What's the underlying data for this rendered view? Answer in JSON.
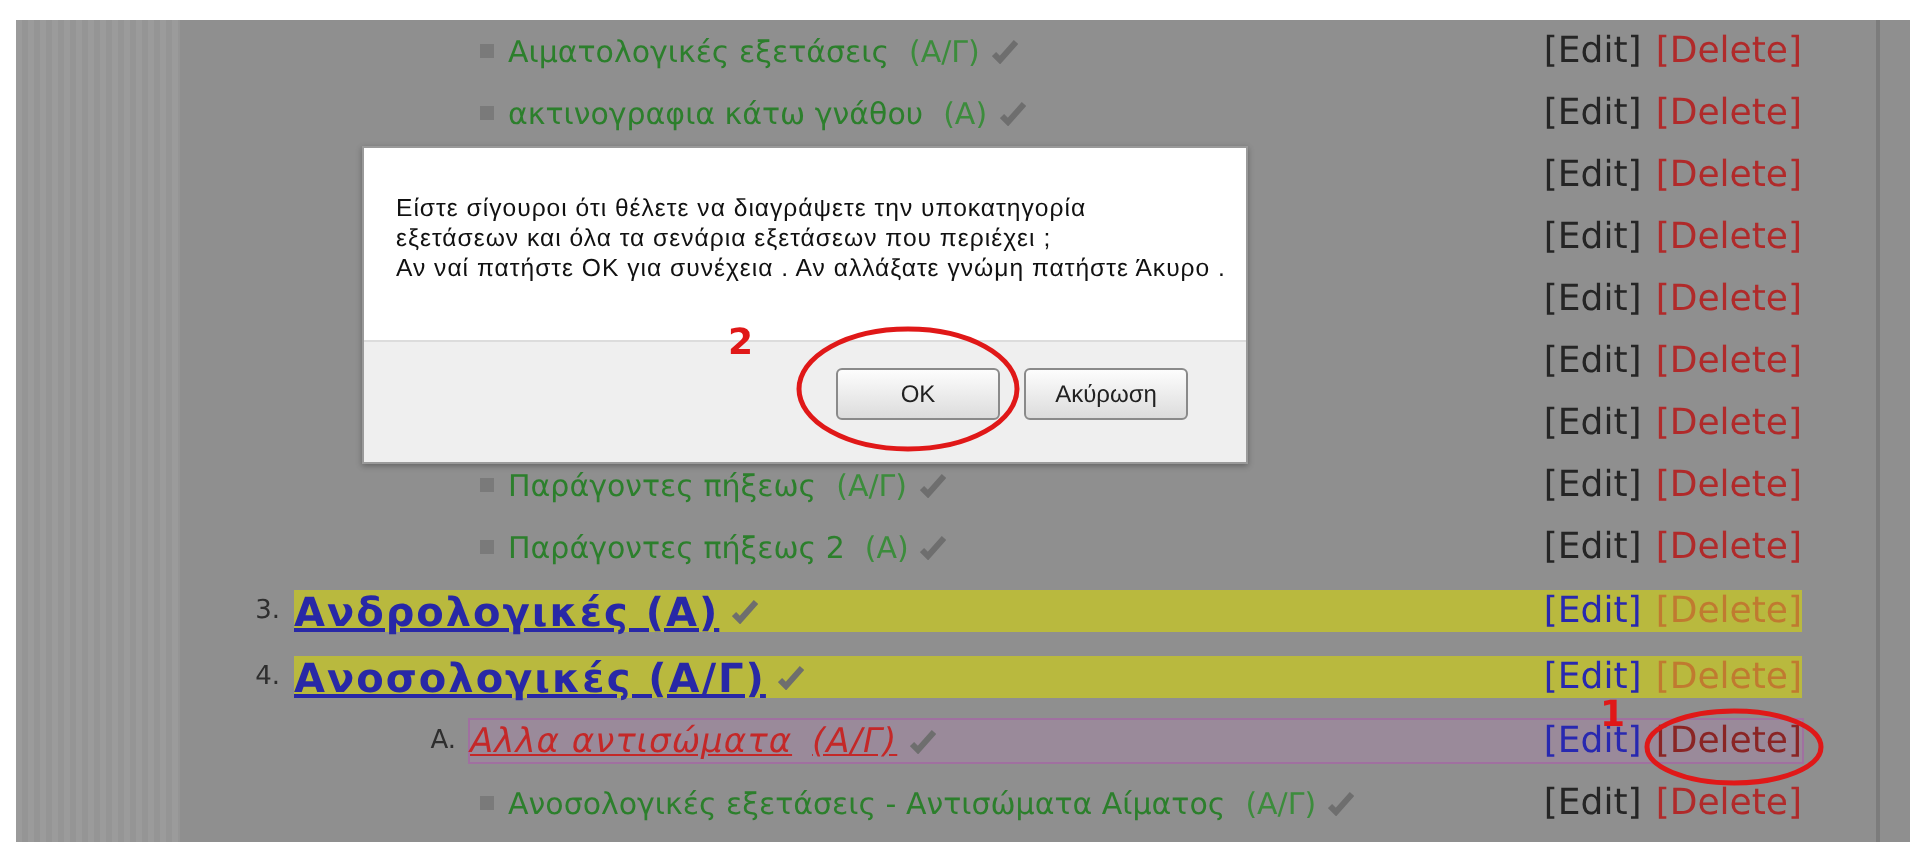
{
  "entries": [
    {
      "kind": "item",
      "name": "Αιματολογικές εξετάσεις",
      "tag": "(Α/Γ)",
      "edit": "[Edit]",
      "delete": "[Delete]"
    },
    {
      "kind": "item",
      "name": "ακτινογραφια κάτω γνάθου",
      "tag": "(Α)",
      "edit": "[Edit]",
      "delete": "[Delete]"
    },
    {
      "kind": "item",
      "edit": "[Edit]",
      "delete": "[Delete]"
    },
    {
      "kind": "item",
      "edit": "[Edit]",
      "delete": "[Delete]"
    },
    {
      "kind": "item",
      "edit": "[Edit]",
      "delete": "[Delete]"
    },
    {
      "kind": "item",
      "edit": "[Edit]",
      "delete": "[Delete]"
    },
    {
      "kind": "item",
      "edit": "[Edit]",
      "delete": "[Delete]"
    },
    {
      "kind": "item",
      "name": "Παράγοντες πήξεως",
      "tag": "(Α/Γ)",
      "edit": "[Edit]",
      "delete": "[Delete]"
    },
    {
      "kind": "item",
      "name": "Παράγοντες πήξεως 2",
      "tag": "(Α)",
      "edit": "[Edit]",
      "delete": "[Delete]"
    },
    {
      "kind": "category",
      "number": "3.",
      "name": "Ανδρολογικές (Α)",
      "edit": "[Edit]",
      "delete": "[Delete]"
    },
    {
      "kind": "category",
      "number": "4.",
      "name": "Ανοσολογικές (Α/Γ)",
      "edit": "[Edit]",
      "delete": "[Delete]",
      "children": [
        {
          "kind": "subcategory",
          "number": "A.",
          "name": "Αλλα αντισώματα",
          "tag": "(Α/Γ)",
          "edit": "[Edit]",
          "delete": "[Delete]",
          "children": [
            {
              "kind": "item",
              "name": "Ανοσολογικές εξετάσεις - Αντισώματα Αίματος",
              "tag": "(Α/Γ)",
              "edit": "[Edit]",
              "delete": "[Delete]"
            }
          ]
        }
      ]
    }
  ],
  "dialog": {
    "message_lines": [
      "Είστε σίγουροι ότι θέλετε να διαγράψετε την υποκατηγορία",
      "εξετάσεων και όλα τα σενάρια εξετάσεων που περιέχει  ;",
      "Αν ναί πατήστε ΟΚ για συνέχεια . Αν αλλάξατε γνώμη πατήστε Άκυρο ."
    ],
    "buttons": [
      "OK",
      "Ακύρωση"
    ]
  },
  "annotations": [
    {
      "label": "2"
    },
    {
      "label": "1"
    }
  ]
}
